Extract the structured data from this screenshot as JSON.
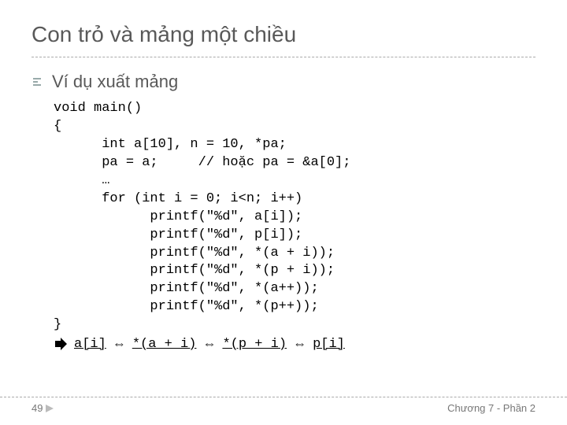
{
  "title": "Con trỏ và mảng một chiều",
  "subtitle": "Ví dụ xuất mảng",
  "code": "void main()\n{\n      int a[10], n = 10, *pa;\n      pa = a;     // hoặc pa = &a[0];\n      …\n      for (int i = 0; i<n; i++)\n            printf(\"%d\", a[i]);\n            printf(\"%d\", p[i]);\n            printf(\"%d\", *(a + i));\n            printf(\"%d\", *(p + i));\n            printf(\"%d\", *(a++));\n            printf(\"%d\", *(p++));\n}",
  "summary": {
    "p1": "a[i]",
    "p2": "*(a + i)",
    "p3": "*(p + i)",
    "p4": "p[i]",
    "sep": "⇔"
  },
  "footer": {
    "page": "49",
    "chapter": "Chương 7 - Phần 2"
  }
}
